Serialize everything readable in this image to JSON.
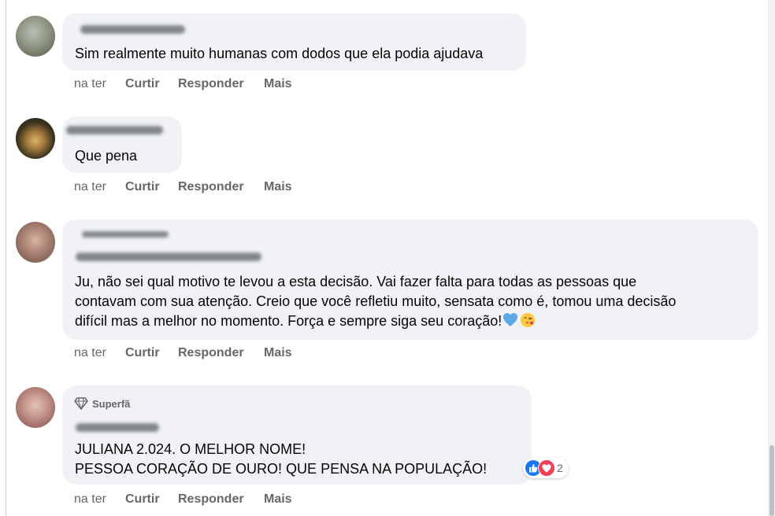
{
  "comments": [
    {
      "text_lines": [
        "Sim realmente muito humanas com dodos que ela podia ajudava"
      ],
      "actions": {
        "time": "na ter",
        "like": "Curtir",
        "reply": "Responder",
        "more": "Mais"
      }
    },
    {
      "text_lines": [
        "Que pena"
      ],
      "actions": {
        "time": "na ter",
        "like": "Curtir",
        "reply": "Responder",
        "more": "Mais"
      }
    },
    {
      "text_lines": [
        "Ju, não sei qual motivo te levou a esta decisão. Vai fazer falta para todas as pessoas que",
        "contavam com sua atenção. Creio que você refletiu muito, sensata como é, tomou uma decisão",
        "difícil mas a melhor no momento. Força e sempre siga seu coração!"
      ],
      "emojis": [
        "blue-heart-icon",
        "face-blowing-kiss-icon"
      ],
      "actions": {
        "time": "na ter",
        "like": "Curtir",
        "reply": "Responder",
        "more": "Mais"
      }
    },
    {
      "badge": "Superfã",
      "badge_icon": "diamond-icon",
      "text_lines": [
        "JULIANA 2.024. O MELHOR NOME!",
        "PESSOA CORAÇÃO DE OURO! QUE PENSA NA POPULAÇÃO!"
      ],
      "reactions": {
        "icons": [
          "like-reaction-icon",
          "love-reaction-icon"
        ],
        "count": "2"
      },
      "actions": {
        "time": "na ter",
        "like": "Curtir",
        "reply": "Responder",
        "more": "Mais"
      }
    }
  ],
  "colors": {
    "bubble": "#f0f2f5",
    "text": "#050505",
    "secondary": "#65676b",
    "like_blue": "#1877f2",
    "love_red": "#f33e58",
    "heart_blue": "#5aa9e6"
  }
}
